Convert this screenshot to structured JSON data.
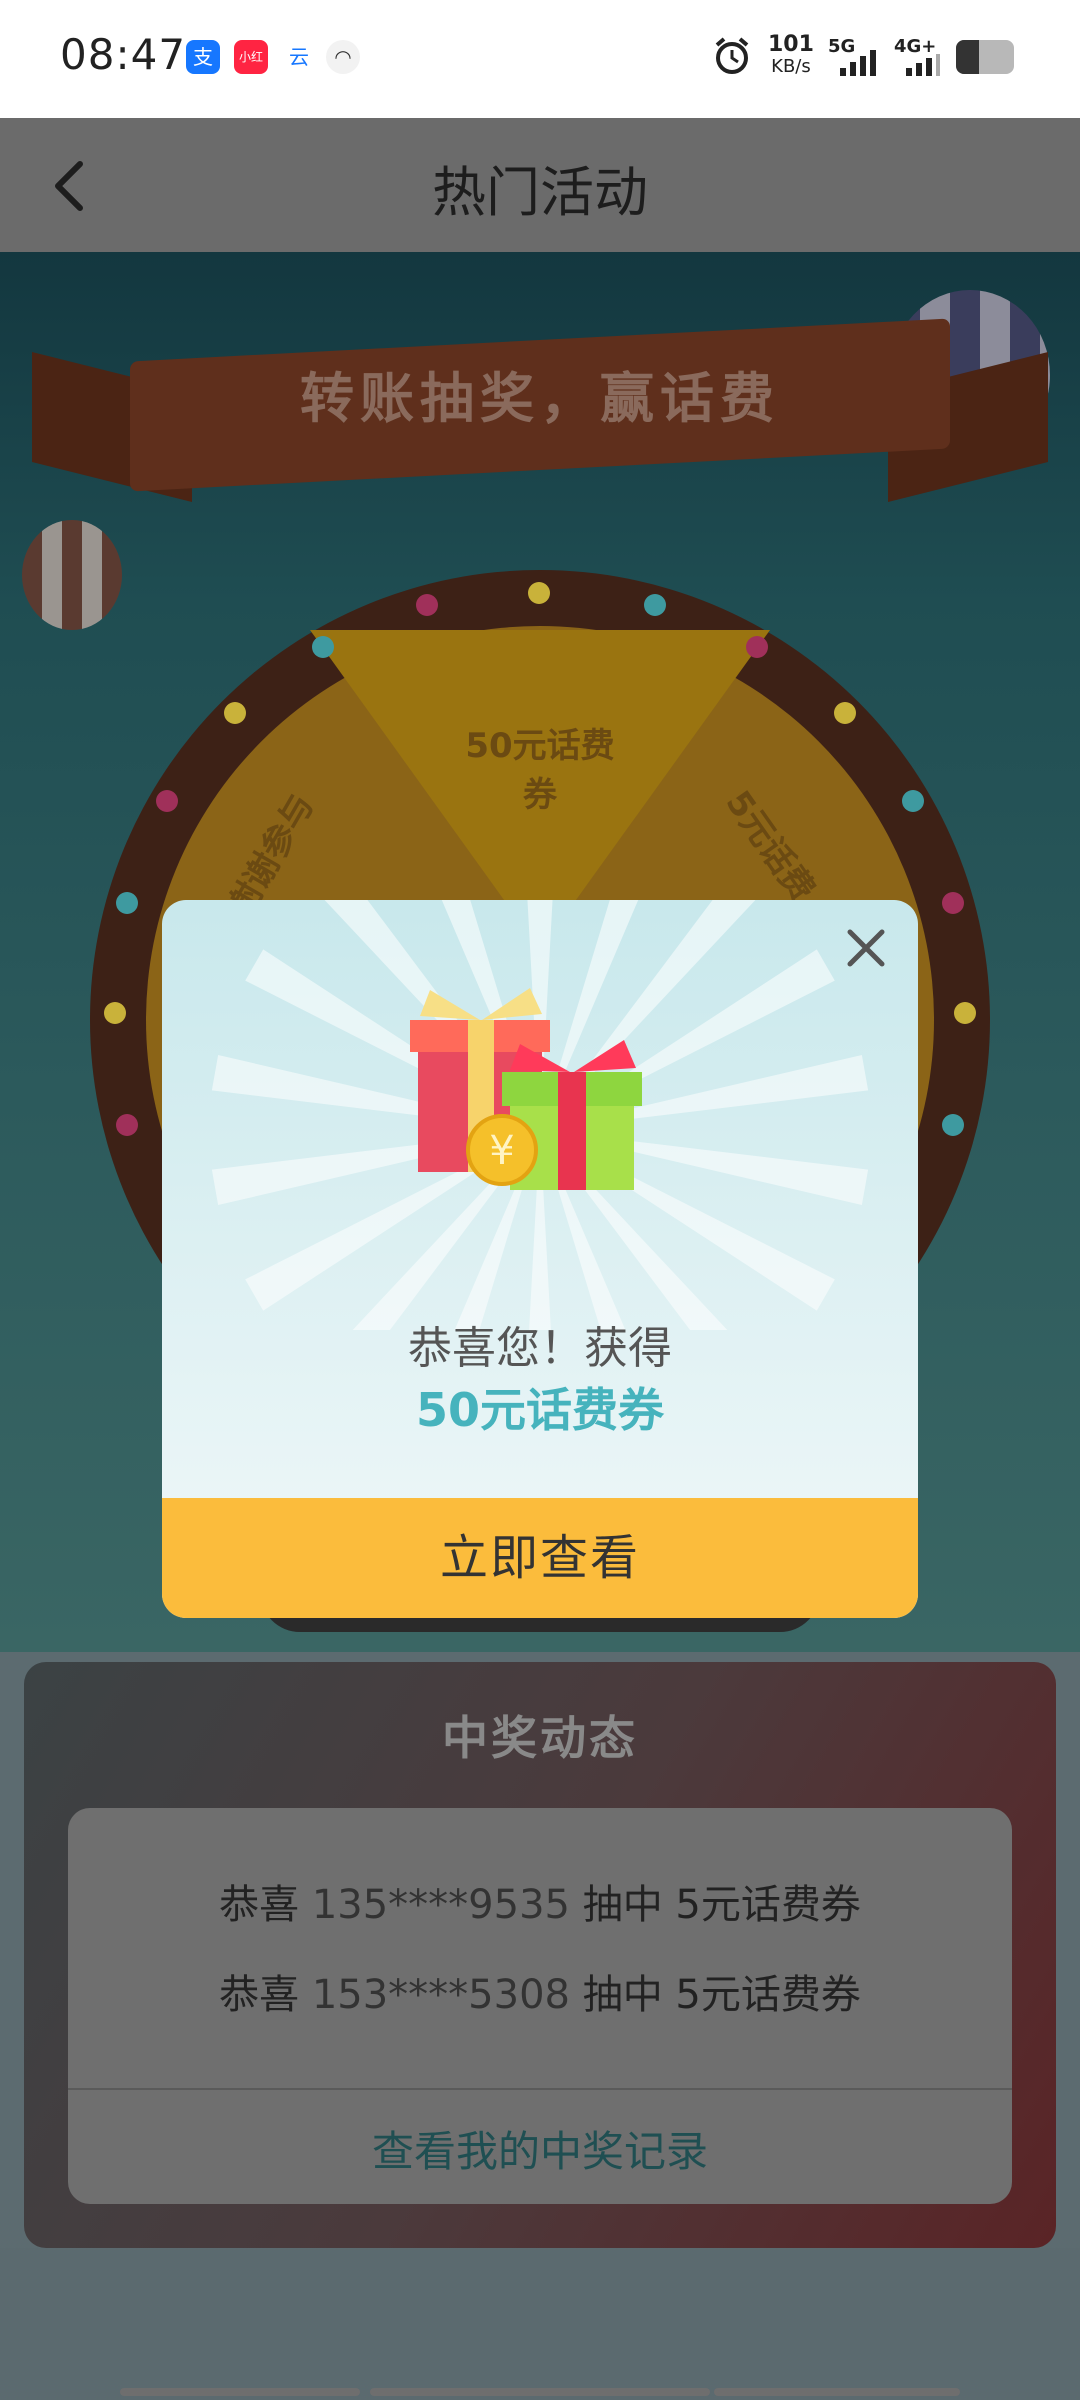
{
  "status_bar": {
    "time": "08:47",
    "apps": [
      {
        "label": "支",
        "color": "#1677ff"
      },
      {
        "label": "小红书",
        "color": "#ff2442"
      },
      {
        "label": "云",
        "color": "#ffffff"
      },
      {
        "label": "◠",
        "color": "#ffffff"
      }
    ],
    "speed_value": "101",
    "speed_unit": "KB/s",
    "net1": "5G",
    "net2": "4G+",
    "battery_level": 0.4
  },
  "header": {
    "title": "热门活动"
  },
  "campaign": {
    "banner_text": "转账抽奖，赢话费",
    "wheel_labels": [
      "50元话费",
      "券",
      "5元话费",
      "谢谢参与"
    ]
  },
  "winners": {
    "title": "中奖动态",
    "rows": [
      {
        "prefix": "恭喜 ",
        "phone": "135****9535",
        "suffix": " 抽中 5元话费券"
      },
      {
        "prefix": "恭喜 ",
        "phone": "153****5308",
        "suffix": " 抽中 5元话费券"
      }
    ],
    "link": "查看我的中奖记录"
  },
  "modal": {
    "message": "恭喜您！获得",
    "prize": "50元话费券",
    "button": "立即查看"
  },
  "colors": {
    "accent": "#fbbc3c",
    "prize_text": "#46b3bd"
  }
}
